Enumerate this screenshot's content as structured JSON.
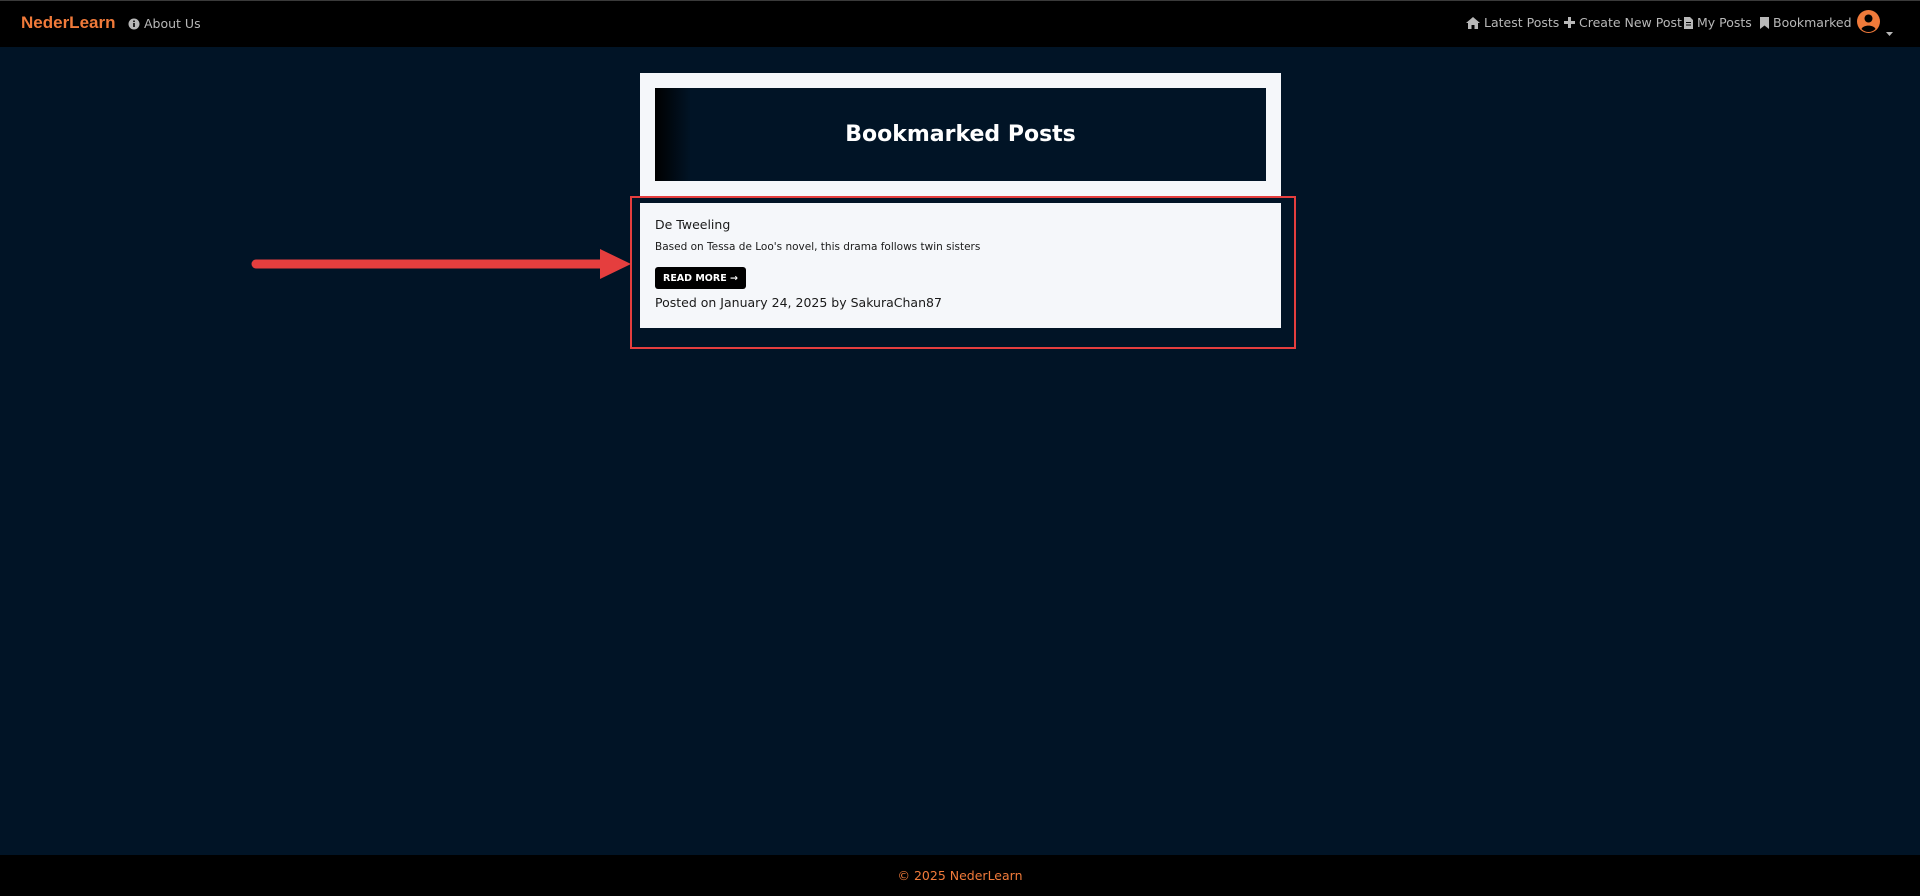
{
  "navbar": {
    "brand": "NederLearn",
    "about_label": "About Us",
    "links": {
      "latest": "Latest Posts",
      "create": "Create New Post",
      "my_posts": "My Posts",
      "bookmarked": "Bookmarked"
    },
    "icons": {
      "about": "info-circle-icon",
      "latest": "home-icon",
      "create": "plus-icon",
      "my_posts": "file-icon",
      "bookmarked": "bookmark-icon",
      "user": "user-circle-icon",
      "menu": "caret-down-icon"
    }
  },
  "header": {
    "title": "Bookmarked Posts"
  },
  "posts": [
    {
      "title": "De Tweeling",
      "excerpt": "Based on Tessa de Loo's novel, this drama follows twin sisters",
      "read_more": "READ MORE →",
      "meta": "Posted on January 24, 2025 by SakuraChan87"
    }
  ],
  "footer": {
    "text": "© 2025 NederLearn"
  },
  "colors": {
    "page_bg": "#011426",
    "navbar_bg": "#000000",
    "brand": "#f07a3a",
    "nav_text": "#b8b8b8",
    "card_bg": "#f5f7fa",
    "annotation": "#e53e3e",
    "footer_text": "#f07a3a"
  }
}
